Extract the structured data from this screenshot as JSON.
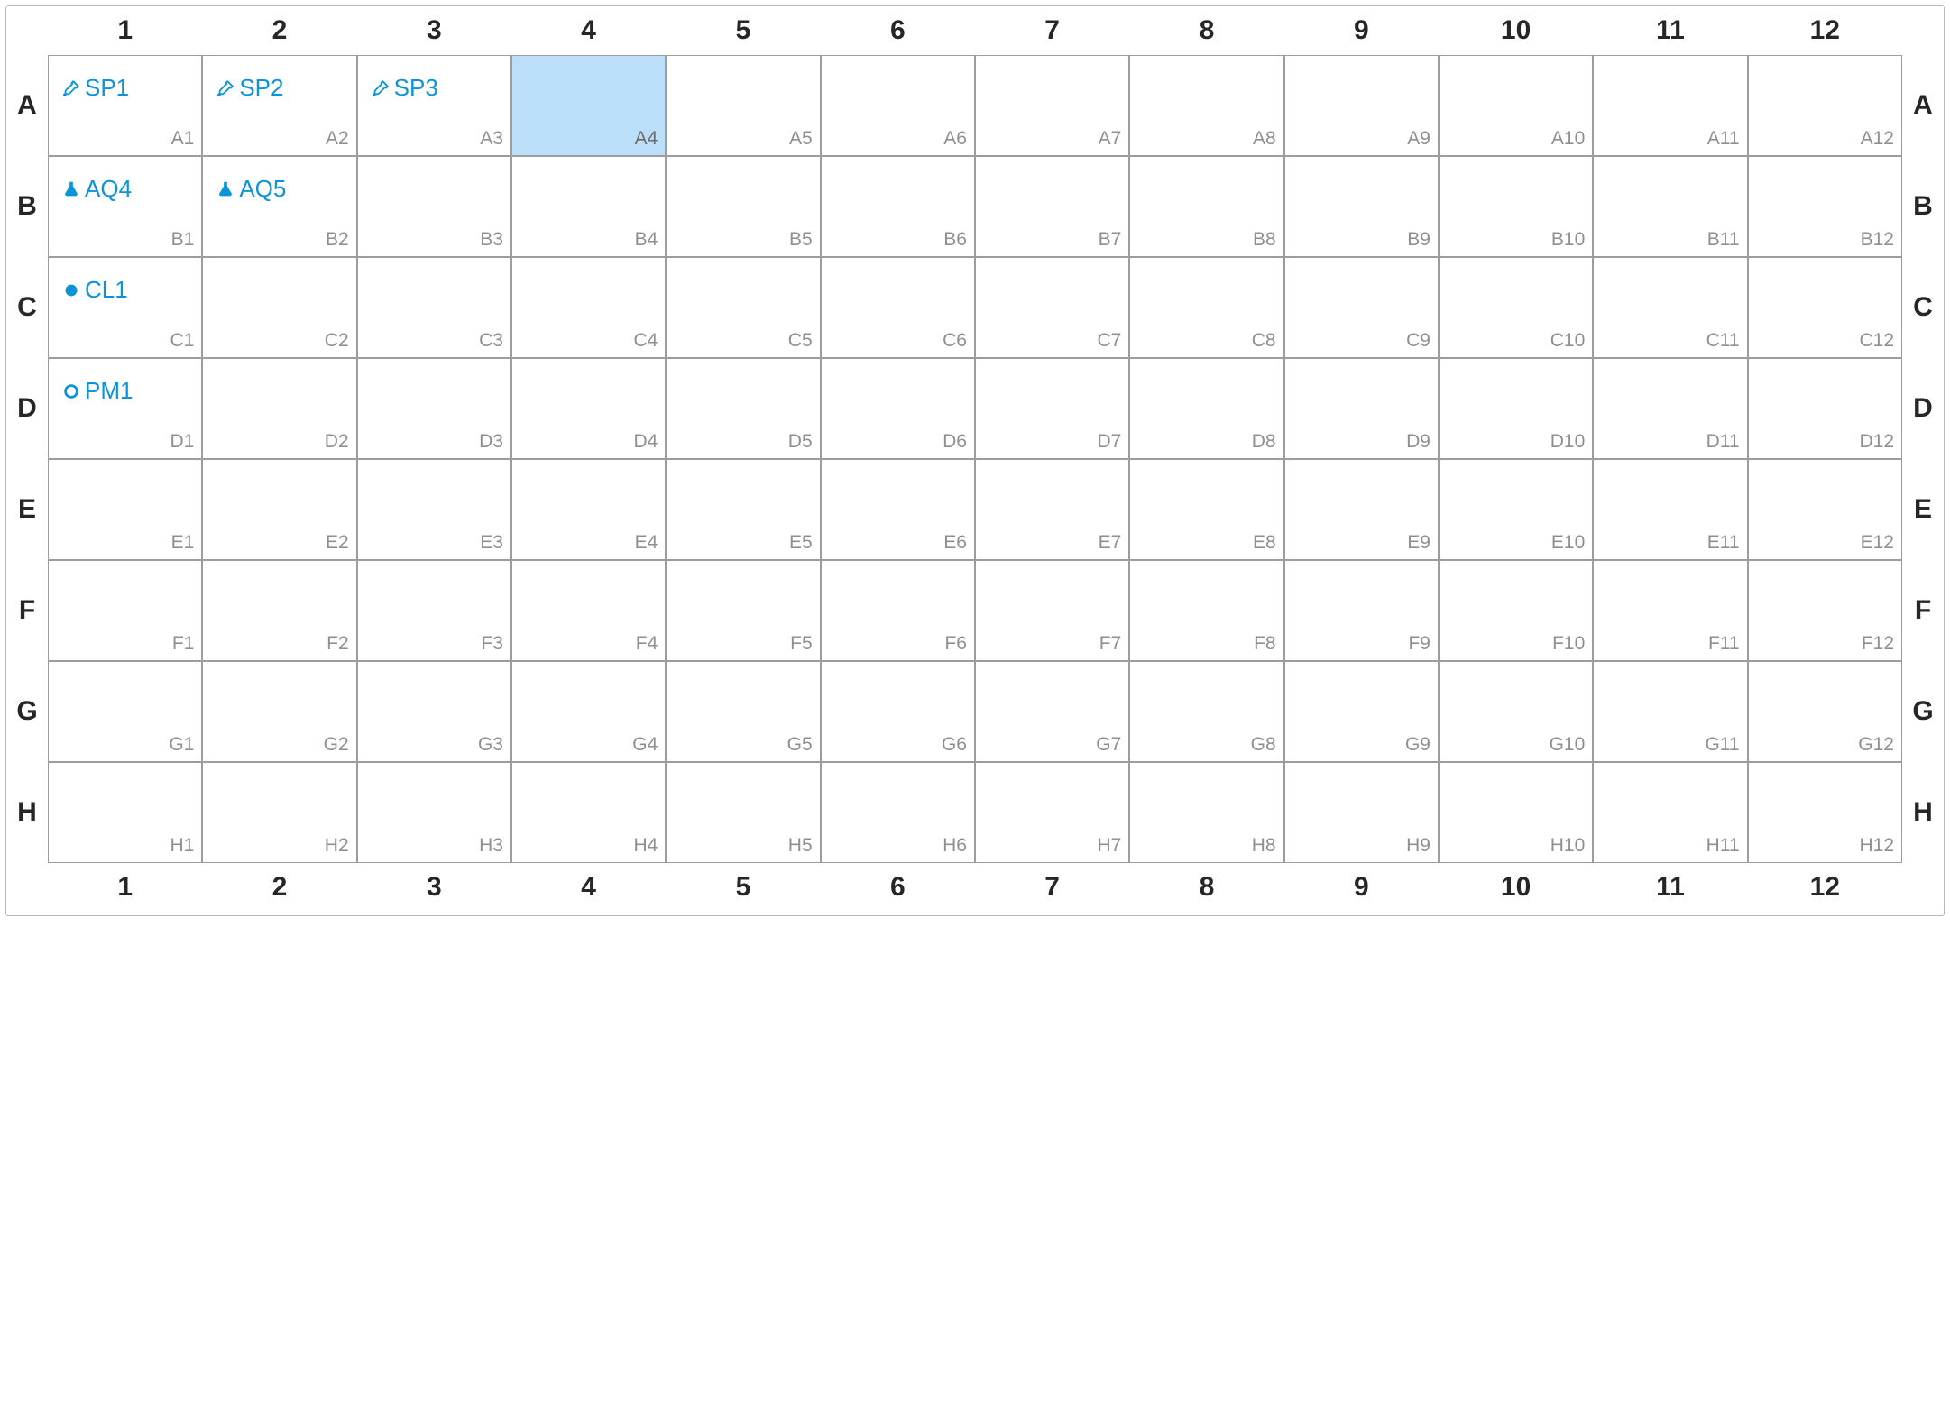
{
  "plate": {
    "rows": [
      "A",
      "B",
      "C",
      "D",
      "E",
      "F",
      "G",
      "H"
    ],
    "columns": [
      "1",
      "2",
      "3",
      "4",
      "5",
      "6",
      "7",
      "8",
      "9",
      "10",
      "11",
      "12"
    ],
    "selected": [
      "A4"
    ],
    "wells": {
      "A1": {
        "label": "SP1",
        "icon": "dropper"
      },
      "A2": {
        "label": "SP2",
        "icon": "dropper"
      },
      "A3": {
        "label": "SP3",
        "icon": "dropper"
      },
      "B1": {
        "label": "AQ4",
        "icon": "flask"
      },
      "B2": {
        "label": "AQ5",
        "icon": "flask"
      },
      "C1": {
        "label": "CL1",
        "icon": "dot-filled"
      },
      "D1": {
        "label": "PM1",
        "icon": "dot-outline"
      }
    }
  },
  "colors": {
    "accent": "#0c94da",
    "selected_bg": "#bbdef9",
    "grid_border": "#9d9d9d",
    "coord_text": "#8f8f8f"
  }
}
